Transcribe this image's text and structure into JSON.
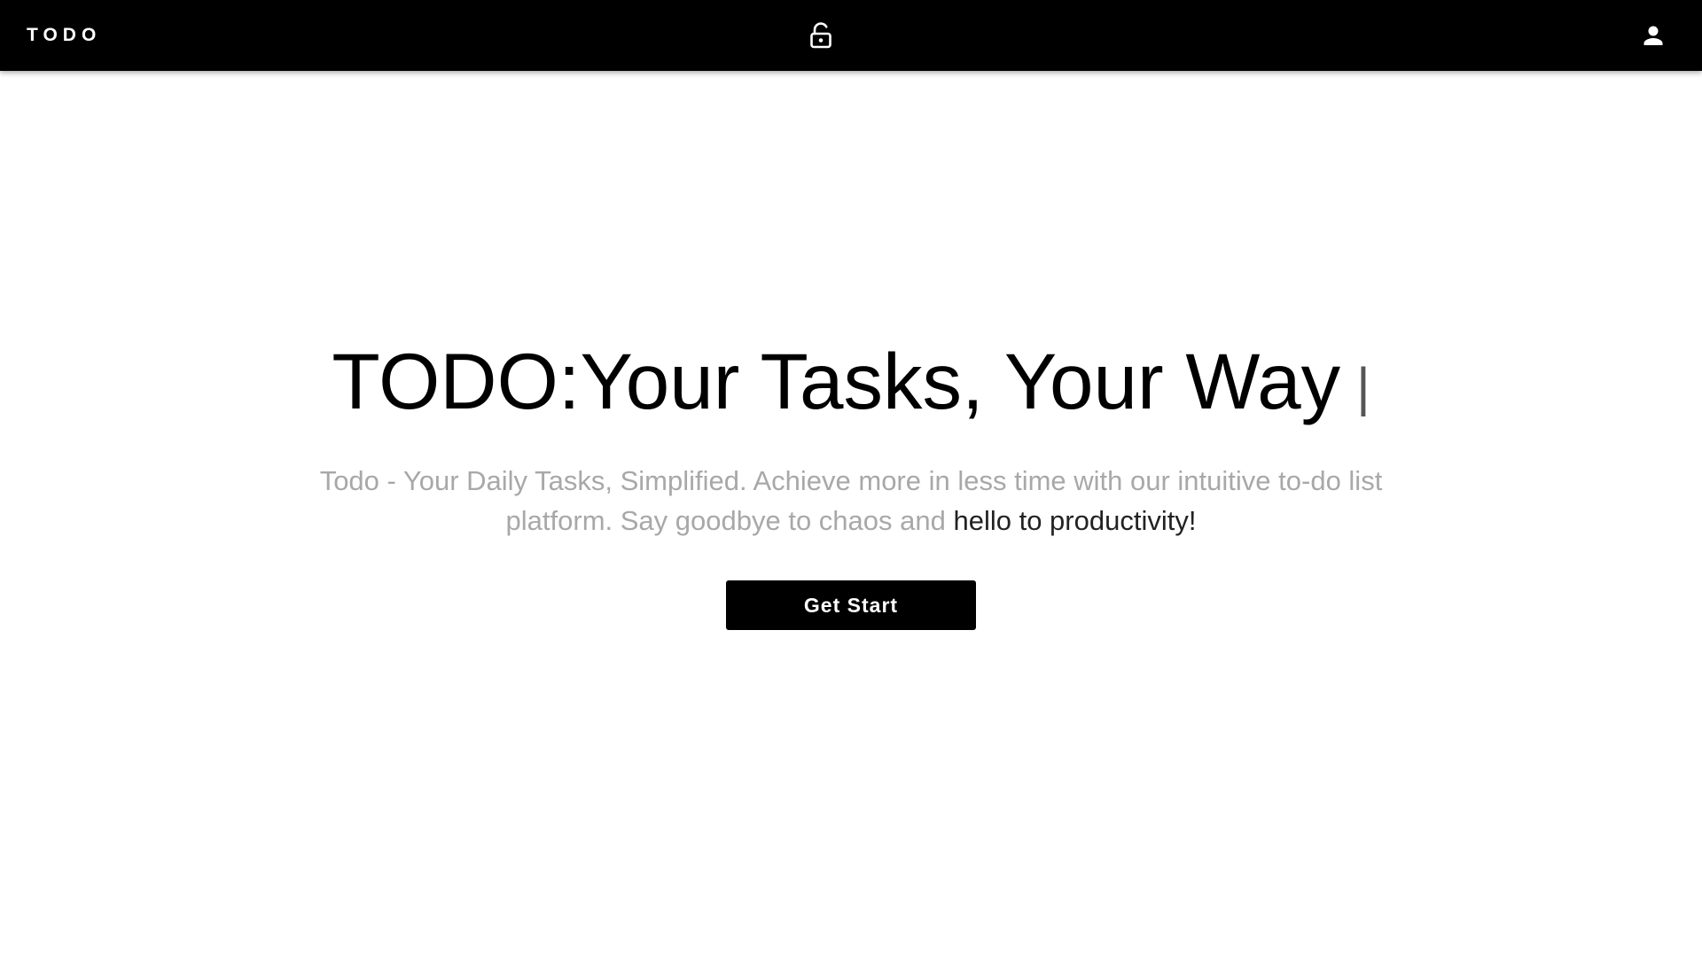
{
  "navbar": {
    "brand": "TODO",
    "lock_icon": "lock-open-icon",
    "user_icon": "user-icon",
    "background": "#000000",
    "text_color": "#ffffff"
  },
  "hero": {
    "title": "TODO:Your Tasks, Your Way",
    "cursor": "|",
    "subtitle_muted": "Todo - Your Daily Tasks, Simplified. Achieve more in less time with our intuitive to-do list platform. Say goodbye to chaos and ",
    "subtitle_highlight": "hello to productivity!",
    "cta_label": "Get Start",
    "muted_color": "#a8a8a8",
    "highlight_color": "#222222"
  }
}
